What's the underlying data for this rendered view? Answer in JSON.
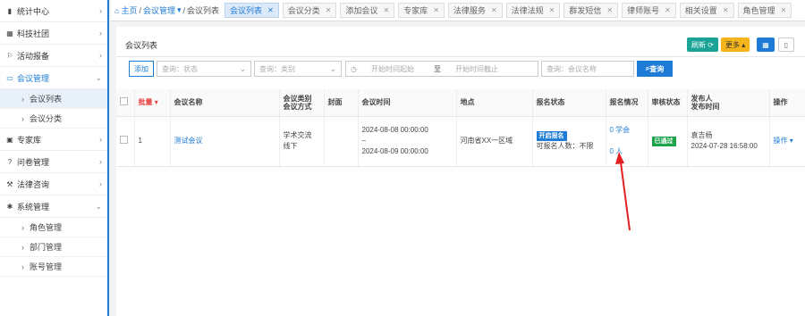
{
  "sidebar": {
    "items": [
      {
        "label": "统计中心",
        "icon": "bar-chart-icon"
      },
      {
        "label": "科技社团",
        "icon": "grid-icon"
      },
      {
        "label": "活动报备",
        "icon": "flag-icon"
      },
      {
        "label": "会议管理",
        "icon": "monitor-icon"
      },
      {
        "label": "专家库",
        "icon": "book-icon"
      },
      {
        "label": "问卷管理",
        "icon": "help-circle-icon"
      },
      {
        "label": "法律咨询",
        "icon": "gavel-icon"
      },
      {
        "label": "系统管理",
        "icon": "gear-icon"
      }
    ],
    "meeting_sub": [
      "会议列表",
      "会议分类"
    ],
    "system_sub": [
      "角色管理",
      "部门管理",
      "账号管理"
    ]
  },
  "tabbar": {
    "home": "主页",
    "crumb1": "会议管理",
    "crumb2": "会议列表",
    "tabs": [
      "会议列表",
      "会议分类",
      "添加会议",
      "专家库",
      "法律服务",
      "法律法规",
      "群发短信",
      "律师账号",
      "相关设置",
      "角色管理"
    ]
  },
  "panel": {
    "title": "会议列表",
    "refresh": "刷新",
    "more": "更多"
  },
  "filters": {
    "add": "添加",
    "status_placeholder": "查询：状态",
    "type_placeholder": "查询：类别",
    "start_placeholder": "开始时间起始",
    "range_sep": "至",
    "end_placeholder": "开始时间截止",
    "name_placeholder": "查询：会议名称",
    "search": "查询"
  },
  "table": {
    "headers": {
      "batch": "批量",
      "name": "会议名称",
      "type_line1": "会议类别",
      "type_line2": "会议方式",
      "cover": "封面",
      "time": "会议时间",
      "place": "地点",
      "signup_status": "报名状态",
      "signup_info": "报名情况",
      "audit": "审核状态",
      "publisher_line1": "发布人",
      "publisher_line2": "发布时间",
      "actions": "操作"
    },
    "rows": [
      {
        "index": "1",
        "name": "测试会议",
        "type": "学术交流",
        "mode": "线下",
        "time_start": "2024-08-08 00:00:00",
        "time_sep": "–",
        "time_end": "2024-08-09 00:00:00",
        "place": "河南省XX一区域",
        "signup_badge": "开启报名",
        "signup_limit": "可报名人数：不限",
        "signup_count1": "0 学会",
        "signup_count2": "0 人",
        "audit_badge": "已通过",
        "publisher": "袁吉杨",
        "publish_time": "2024-07-28 16:58:00",
        "action": "操作"
      }
    ]
  },
  "colors": {
    "primary": "#1e7cd6",
    "success": "#1aa34a",
    "teal": "#1aa396",
    "warning": "#f3b51b",
    "danger": "#e63b3b"
  }
}
